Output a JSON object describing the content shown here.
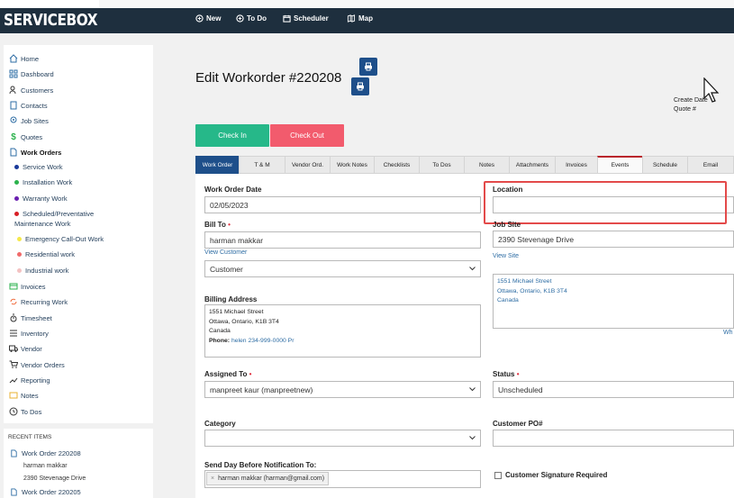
{
  "app": {
    "brand": "SERVICEBOX"
  },
  "topnav": [
    {
      "label": "New",
      "icon": "plus-circle-icon"
    },
    {
      "label": "To Do",
      "icon": "plus-circle-icon"
    },
    {
      "label": "Scheduler",
      "icon": "calendar-icon"
    },
    {
      "label": "Map",
      "icon": "map-icon"
    }
  ],
  "sidebar": {
    "items": [
      {
        "label": "Home",
        "icon": "home-icon"
      },
      {
        "label": "Dashboard",
        "icon": "grid-icon"
      },
      {
        "label": "Customers",
        "icon": "users-icon"
      },
      {
        "label": "Contacts",
        "icon": "contacts-icon"
      },
      {
        "label": "Job Sites",
        "icon": "pin-icon"
      },
      {
        "label": "Quotes",
        "icon": "dollar-icon"
      },
      {
        "label": "Work Orders",
        "icon": "document-icon"
      }
    ],
    "work_order_types": [
      {
        "label": "Service Work",
        "color": "#1a3a9a"
      },
      {
        "label": "Installation Work",
        "color": "#2bb24c"
      },
      {
        "label": "Warranty Work",
        "color": "#6a1fb0"
      },
      {
        "label": "Scheduled/Preventative",
        "label2": "Maintenance Work",
        "color": "#d81f26"
      },
      {
        "label": "Emergency Call-Out Work",
        "color": "#f5e84a"
      },
      {
        "label": "Residential work",
        "color": "#f06a6a"
      },
      {
        "label": "Industrial work",
        "color": "#f3c2c2"
      }
    ],
    "items2": [
      {
        "label": "Invoices",
        "icon": "invoice-icon"
      },
      {
        "label": "Recurring Work",
        "icon": "recurring-icon"
      },
      {
        "label": "Timesheet",
        "icon": "stopwatch-icon"
      },
      {
        "label": "Inventory",
        "icon": "list-icon"
      },
      {
        "label": "Vendor",
        "icon": "truck-icon"
      },
      {
        "label": "Vendor Orders",
        "icon": "cart-icon"
      },
      {
        "label": "Reporting",
        "icon": "chart-icon"
      },
      {
        "label": "Notes",
        "icon": "notes-icon"
      },
      {
        "label": "To Dos",
        "icon": "clock-icon"
      }
    ]
  },
  "recent": {
    "heading": "RECENT ITEMS",
    "items": [
      {
        "label": "Work Order 220208",
        "sub1": "harman makkar",
        "sub2": "2390 Stevenage Drive"
      },
      {
        "label": "Work Order 220205"
      }
    ]
  },
  "page": {
    "title": "Edit Workorder #220208",
    "create_date": "Create Date",
    "quote_no": "Quote #",
    "check_in": "Check In",
    "check_out": "Check Out"
  },
  "tabs": [
    "Work Order",
    "T & M",
    "Vendor Ord.",
    "Work Notes",
    "Checklists",
    "To Dos",
    "Notes",
    "Attachments",
    "Invoices",
    "Events",
    "Schedule",
    "Email"
  ],
  "form": {
    "work_order_date_label": "Work Order Date",
    "work_order_date": "02/05/2023",
    "location_label": "Location",
    "location_value": "",
    "bill_to_label": "Bill To",
    "bill_to_value": "harman makkar",
    "view_customer": "View Customer",
    "customer_type": "Customer",
    "job_site_label": "Job Site",
    "job_site_value": "2390 Stevenage Drive",
    "view_site": "View Site",
    "job_site_address": [
      "1551 Michael Street",
      "Ottawa, Ontario, K1B 3T4",
      "Canada"
    ],
    "job_site_more": "Wh",
    "billing_address_label": "Billing Address",
    "billing_address": [
      "1551 Michael Street",
      "Ottawa, Ontario, K1B 3T4",
      "Canada"
    ],
    "phone_label": "Phone:",
    "phone_value": "helen 234-999-0000 Pr",
    "assigned_to_label": "Assigned To",
    "assigned_to_value": "manpreet kaur (manpreetnew)",
    "status_label": "Status",
    "status_value": "Unscheduled",
    "category_label": "Category",
    "category_value": "",
    "customer_po_label": "Customer PO#",
    "customer_po_value": "",
    "notify_label": "Send Day Before Notification To:",
    "notify_tag": "harman makkar (harman@gmail.com)",
    "signature_label": "Customer Signature Required"
  }
}
